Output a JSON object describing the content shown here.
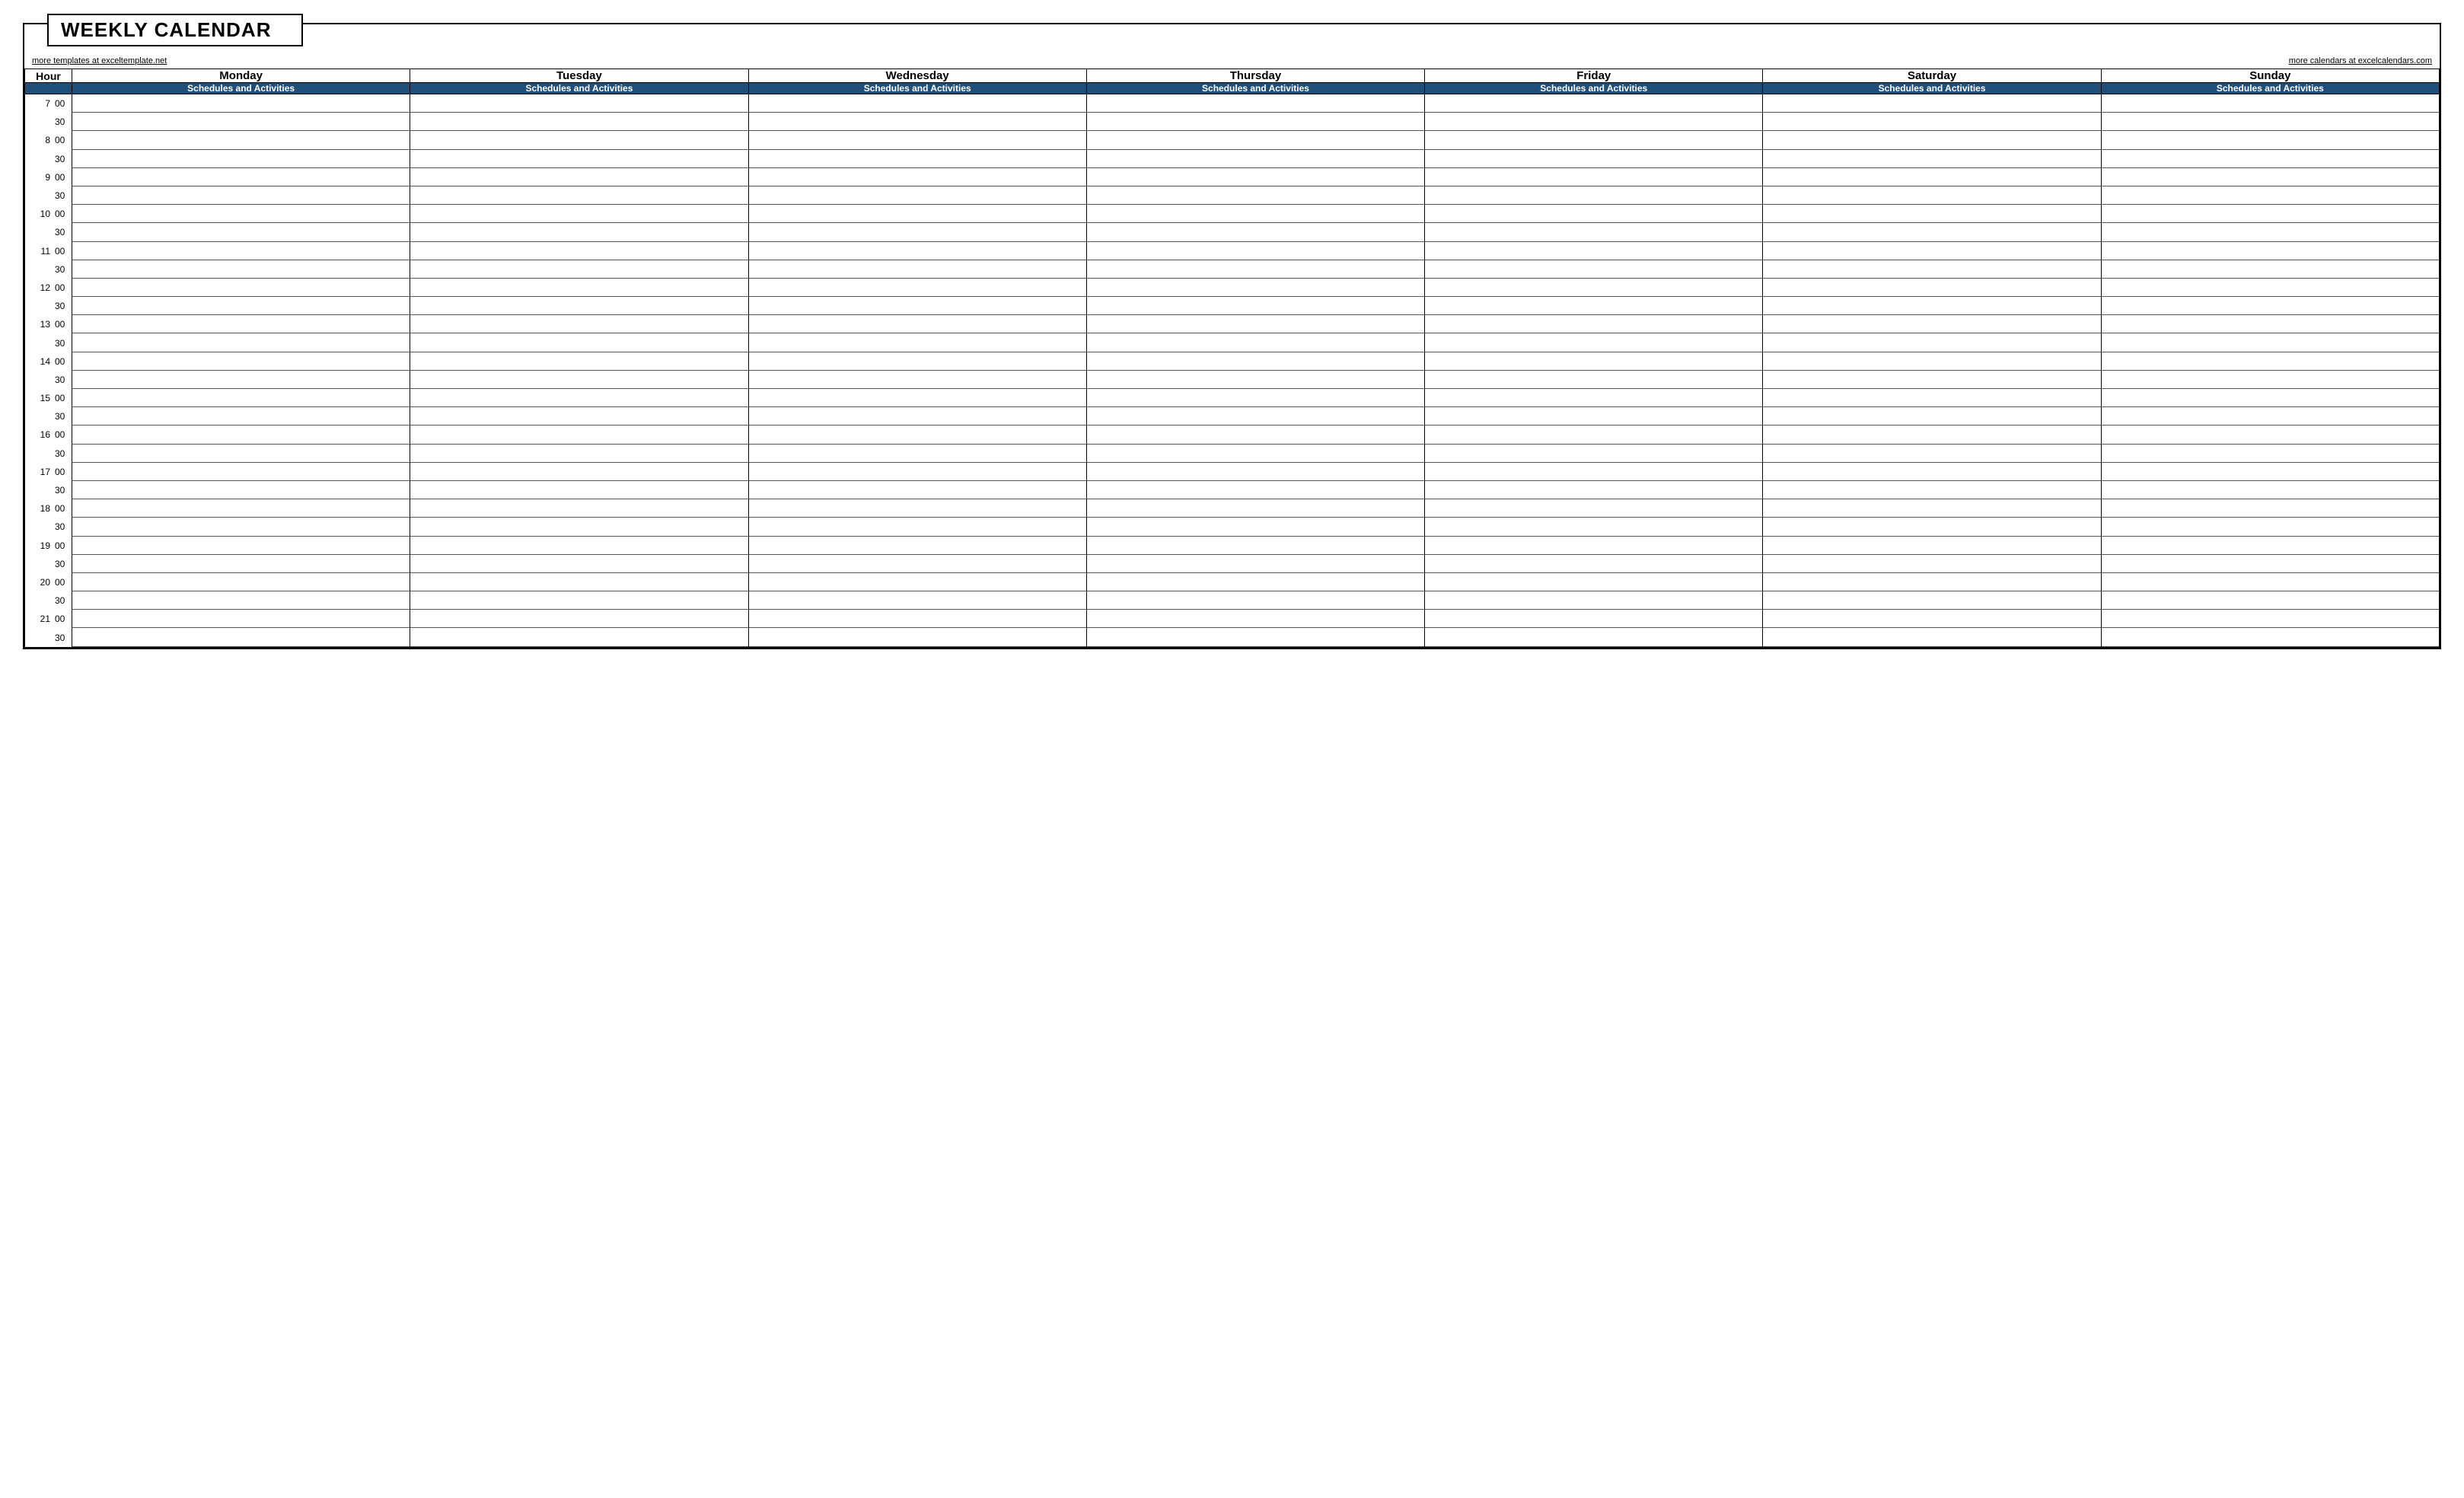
{
  "title": "WEEKLY CALENDAR",
  "link_left": "more templates at exceltemplate.net",
  "link_right": "more calendars at excelcalendars.com",
  "hour_label": "Hour",
  "subheader": "Schedules and Activities",
  "days": [
    "Monday",
    "Tuesday",
    "Wednesday",
    "Thursday",
    "Friday",
    "Saturday",
    "Sunday"
  ],
  "time_slots": [
    {
      "hour": "7",
      "min": "00"
    },
    {
      "hour": "",
      "min": "30"
    },
    {
      "hour": "8",
      "min": "00"
    },
    {
      "hour": "",
      "min": "30"
    },
    {
      "hour": "9",
      "min": "00"
    },
    {
      "hour": "",
      "min": "30"
    },
    {
      "hour": "10",
      "min": "00"
    },
    {
      "hour": "",
      "min": "30"
    },
    {
      "hour": "11",
      "min": "00"
    },
    {
      "hour": "",
      "min": "30"
    },
    {
      "hour": "12",
      "min": "00"
    },
    {
      "hour": "",
      "min": "30"
    },
    {
      "hour": "13",
      "min": "00"
    },
    {
      "hour": "",
      "min": "30"
    },
    {
      "hour": "14",
      "min": "00"
    },
    {
      "hour": "",
      "min": "30"
    },
    {
      "hour": "15",
      "min": "00"
    },
    {
      "hour": "",
      "min": "30"
    },
    {
      "hour": "16",
      "min": "00"
    },
    {
      "hour": "",
      "min": "30"
    },
    {
      "hour": "17",
      "min": "00"
    },
    {
      "hour": "",
      "min": "30"
    },
    {
      "hour": "18",
      "min": "00"
    },
    {
      "hour": "",
      "min": "30"
    },
    {
      "hour": "19",
      "min": "00"
    },
    {
      "hour": "",
      "min": "30"
    },
    {
      "hour": "20",
      "min": "00"
    },
    {
      "hour": "",
      "min": "30"
    },
    {
      "hour": "21",
      "min": "00"
    },
    {
      "hour": "",
      "min": "30"
    }
  ]
}
